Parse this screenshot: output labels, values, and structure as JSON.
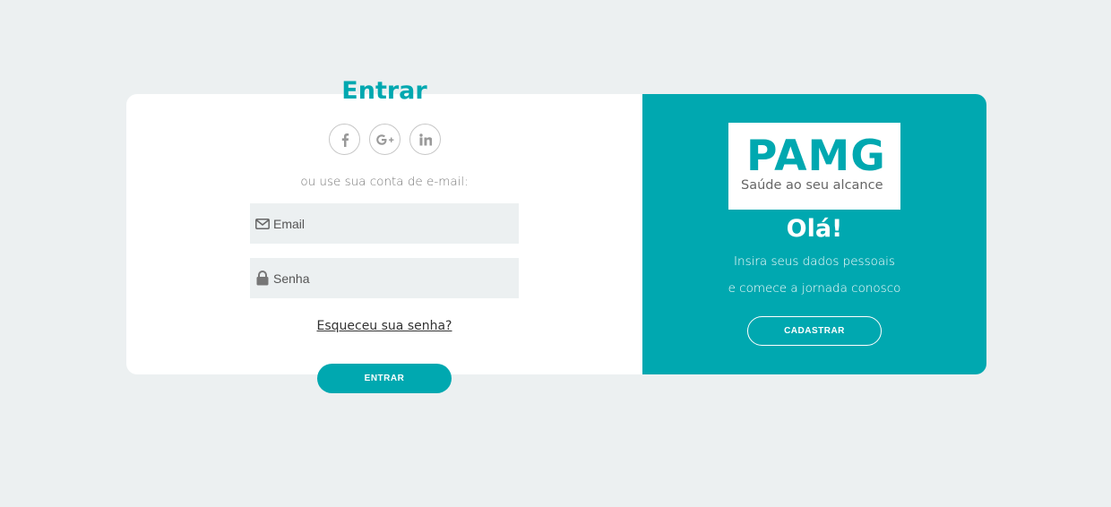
{
  "login": {
    "title": "Entrar",
    "socials": [
      "facebook-icon",
      "google-plus-icon",
      "linkedin-icon"
    ],
    "alt_text": "ou use sua conta de e-mail:",
    "email_placeholder": "Email",
    "password_placeholder": "Senha",
    "forgot_label": "Esqueceu sua senha?",
    "enter_label": "ENTRAR"
  },
  "signup": {
    "logo_brand": "PAMG",
    "logo_tagline": "Saúde ao seu alcance",
    "greeting": "Olá!",
    "message_line1": "Insira seus dados pessoais",
    "message_line2": "e comece a jornada conosco",
    "signup_label": "CADASTRAR"
  },
  "colors": {
    "accent": "#00a8b0",
    "background": "#ecf0f1",
    "field_bg": "#ecf0f1",
    "card": "#ffffff"
  }
}
